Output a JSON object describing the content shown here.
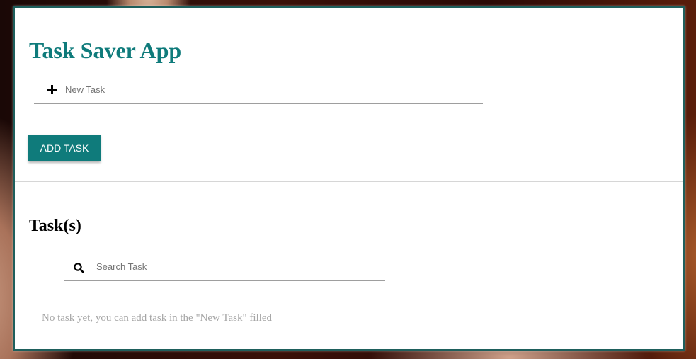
{
  "app": {
    "title": "Task Saver App"
  },
  "new_task": {
    "icon": "plus-icon",
    "value": "",
    "placeholder": "New Task"
  },
  "add_button": {
    "label": "ADD TASK"
  },
  "tasks_section": {
    "heading": "Task(s)",
    "search": {
      "icon": "search-icon",
      "value": "",
      "placeholder": "Search Task"
    },
    "empty_message": "No task yet, you can add task in the \"New Task\" filled"
  },
  "colors": {
    "accent": "#0f7b7b",
    "frame_border": "#1e5f5c",
    "empty_text": "#a6a6a6"
  }
}
